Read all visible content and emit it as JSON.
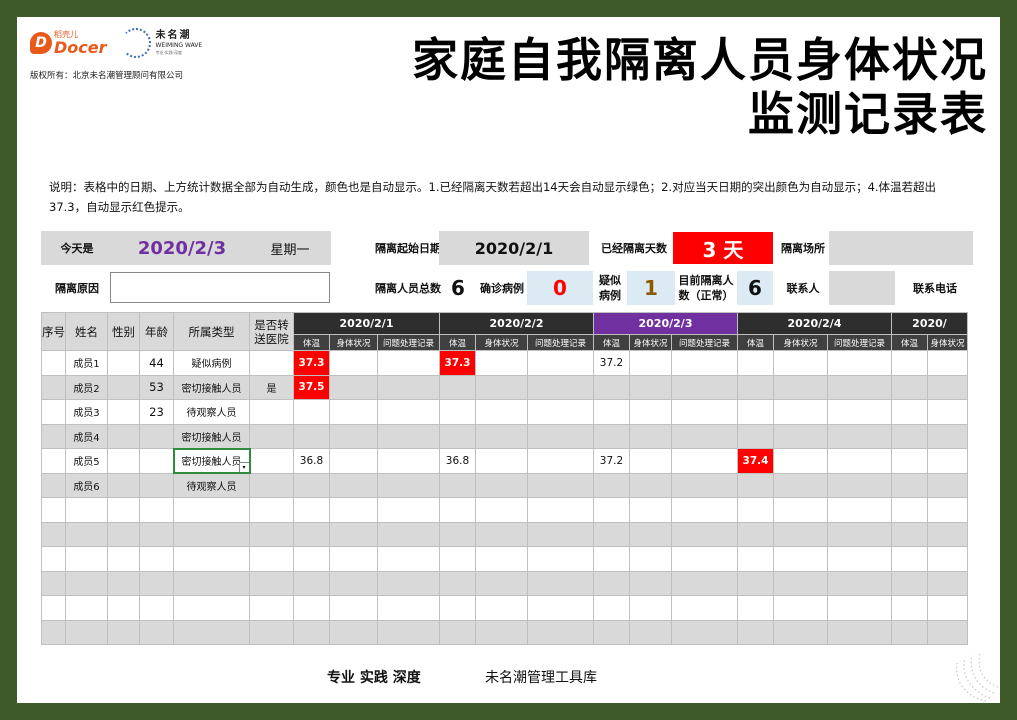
{
  "brand": {
    "docer_cn": "稻壳儿",
    "docer_en": "Docer",
    "docer_mark": "D",
    "wm_cn": "未名潮",
    "wm_en": "WEIMING WAVE",
    "wm_sub": "专业·实践·深度",
    "copyright": "版权所有：北京未名潮管理顾问有限公司"
  },
  "title_line1": "家庭自我隔离人员身体状况",
  "title_line2": "监测记录表",
  "note": "说明：表格中的日期、上方统计数据全部为自动生成，颜色也是自动显示。1.已经隔离天数若超出14天会自动显示绿色；2.对应当天日期的突出颜色为自动显示；4.体温若超出37.3，自动显示红色提示。",
  "info": {
    "today_label": "今天是",
    "today_value": "2020/2/3",
    "weekday": "星期一",
    "start_label": "隔离起始日期",
    "start_value": "2020/2/1",
    "days_label": "已经隔离天数",
    "days_value": "3 天",
    "place_label": "隔离场所",
    "reason_label": "隔离原因",
    "total_label": "隔离人员总数",
    "total_value": "6",
    "confirmed_label": "确诊病例",
    "confirmed_value": "0",
    "suspected_label": "疑似病例",
    "suspected_value": "1",
    "current_label": "目前隔离人数（正常）",
    "current_value": "6",
    "contact_label": "联系人",
    "phone_label": "联系电话"
  },
  "colors": {
    "accent_purple": "#7030a0",
    "alert_red": "#ff0000",
    "frame_green": "#3f5a2a"
  },
  "table": {
    "headers": [
      "序号",
      "姓名",
      "性别",
      "年龄",
      "所属类型",
      "是否转送医院"
    ],
    "dates": [
      "2020/2/1",
      "2020/2/2",
      "2020/2/3",
      "2020/2/4",
      "2020/"
    ],
    "sub_headers": [
      "体温",
      "身体状况",
      "问题处理记录"
    ],
    "rows": [
      {
        "no": "",
        "name": "成员1",
        "gender": "",
        "age": "44",
        "type": "疑似病例",
        "hospital": "",
        "temps": [
          "37.3",
          "37.3",
          "37.2",
          "",
          ""
        ]
      },
      {
        "no": "",
        "name": "成员2",
        "gender": "",
        "age": "53",
        "type": "密切接触人员",
        "hospital": "是",
        "temps": [
          "37.5",
          "",
          "",
          "",
          ""
        ]
      },
      {
        "no": "",
        "name": "成员3",
        "gender": "",
        "age": "23",
        "type": "待观察人员",
        "hospital": "",
        "temps": [
          "",
          "",
          "",
          "",
          ""
        ]
      },
      {
        "no": "",
        "name": "成员4",
        "gender": "",
        "age": "",
        "type": "密切接触人员",
        "hospital": "",
        "temps": [
          "",
          "",
          "",
          "",
          ""
        ]
      },
      {
        "no": "",
        "name": "成员5",
        "gender": "",
        "age": "",
        "type": "密切接触人员",
        "hospital": "",
        "temps": [
          "36.8",
          "36.8",
          "37.2",
          "37.4",
          ""
        ]
      },
      {
        "no": "",
        "name": "成员6",
        "gender": "",
        "age": "",
        "type": "待观察人员",
        "hospital": "",
        "temps": [
          "",
          "",
          "",
          "",
          ""
        ]
      }
    ],
    "empty_rows": 6
  },
  "footer": {
    "left": "专业  实践  深度",
    "right": "未名潮管理工具库"
  }
}
